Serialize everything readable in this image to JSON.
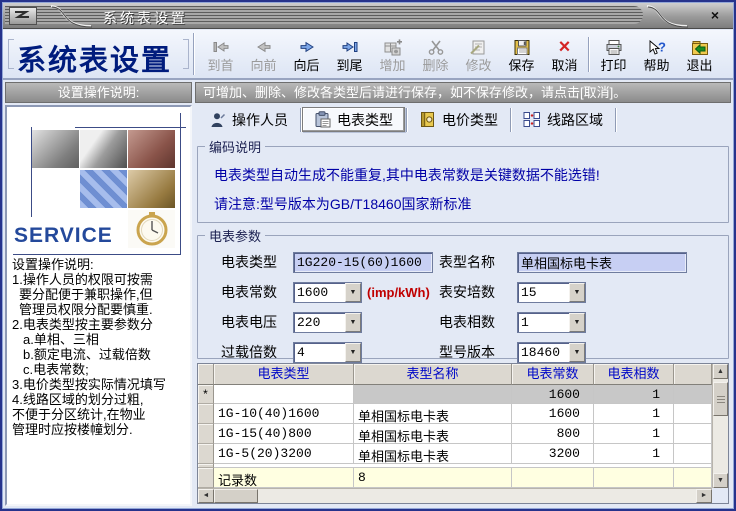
{
  "window": {
    "title": "系统表设置"
  },
  "header": {
    "app_title": "系统表设置"
  },
  "icons": {
    "close": "×",
    "dropdown": "▼",
    "up": "▲",
    "down": "▼",
    "left": "◄",
    "right": "►",
    "cancel_x": "×"
  },
  "toolbar": {
    "buttons": [
      {
        "label": "到首",
        "icon": "go-first-icon",
        "enabled": false
      },
      {
        "label": "向前",
        "icon": "go-prev-icon",
        "enabled": false
      },
      {
        "label": "向后",
        "icon": "go-next-icon",
        "enabled": true
      },
      {
        "label": "到尾",
        "icon": "go-last-icon",
        "enabled": true
      },
      {
        "label": "增加",
        "icon": "add-record-icon",
        "enabled": false
      },
      {
        "label": "删除",
        "icon": "scissors-icon",
        "enabled": false
      },
      {
        "label": "修改",
        "icon": "edit-note-icon",
        "enabled": false
      },
      {
        "label": "保存",
        "icon": "floppy-icon",
        "enabled": true
      },
      {
        "label": "取消",
        "icon": "red-x-icon",
        "enabled": true
      },
      {
        "label": "打印",
        "icon": "printer-icon",
        "enabled": true
      },
      {
        "label": "帮助",
        "icon": "help-cursor-icon",
        "enabled": true
      },
      {
        "label": "退出",
        "icon": "exit-folder-icon",
        "enabled": true
      }
    ]
  },
  "sidebar": {
    "header": "设置操作说明:",
    "service_label": "SERVICE",
    "instructions": [
      "设置操作说明:",
      "1.操作人员的权限可按需",
      "要分配便于兼职操作,但",
      "管理员权限分配要慎重.",
      "2.电表类型按主要参数分",
      "a.单相、三相",
      "b.额定电流、过载倍数",
      "c.电表常数;",
      "3.电价类型按实际情况填写",
      "4.线路区域的划分过粗,",
      "不便于分区统计,在物业",
      "管理时应按楼幢划分."
    ]
  },
  "notice": "可增加、删除、修改各类型后请进行保存，如不保存修改，请点击[取消]。",
  "tabs": [
    {
      "label": "操作人员",
      "icon": "operator-person-icon",
      "selected": false
    },
    {
      "label": "电表类型",
      "icon": "meter-clipboard-icon",
      "selected": true
    },
    {
      "label": "电价类型",
      "icon": "price-book-icon",
      "selected": false
    },
    {
      "label": "线路区域",
      "icon": "line-area-boxes-icon",
      "selected": false
    }
  ],
  "coding_note": {
    "legend": "编码说明",
    "line1": "电表类型自动生成不能重复,其中电表常数是关键数据不能选错!",
    "line2": "请注意:型号版本为GB/T18460国家新标准"
  },
  "params": {
    "legend": "电表参数",
    "meter_type": {
      "label": "电表类型",
      "value": "1G220-15(60)1600"
    },
    "model_name": {
      "label": "表型名称",
      "value": "单相国标电卡表"
    },
    "meter_constant": {
      "label": "电表常数",
      "value": "1600",
      "unit": "(imp/kWh)"
    },
    "amperage": {
      "label": "表安培数",
      "value": "15"
    },
    "voltage": {
      "label": "电表电压",
      "value": "220"
    },
    "phases": {
      "label": "电表相数",
      "value": "1"
    },
    "overload": {
      "label": "过载倍数",
      "value": "4"
    },
    "model_version": {
      "label": "型号版本",
      "value": "18460"
    }
  },
  "grid": {
    "columns": [
      "电表类型",
      "表型名称",
      "电表常数",
      "电表相数"
    ],
    "rows": [
      {
        "marker": "*",
        "meter_type": "",
        "model_name": "",
        "constant": "1600",
        "phases": "1",
        "current": true
      },
      {
        "marker": "",
        "meter_type": "1G-10(40)1600",
        "model_name": "单相国标电卡表",
        "constant": "1600",
        "phases": "1",
        "current": false
      },
      {
        "marker": "",
        "meter_type": "1G-15(40)800",
        "model_name": "单相国标电卡表",
        "constant": "800",
        "phases": "1",
        "current": false
      },
      {
        "marker": "",
        "meter_type": "1G-5(20)3200",
        "model_name": "单相国标电卡表",
        "constant": "3200",
        "phases": "1",
        "current": false
      }
    ],
    "footer": {
      "label": "记录数",
      "value": "8"
    }
  },
  "colors": {
    "accent_navy": "#001c7d",
    "note_blue": "#0000a6",
    "unit_red": "#c00000",
    "field_lavender": "#c7cff3",
    "grid_header_blue": "#0008c8",
    "current_row_gray": "#c8c8c8",
    "footer_yellow": "#ffffe1"
  }
}
